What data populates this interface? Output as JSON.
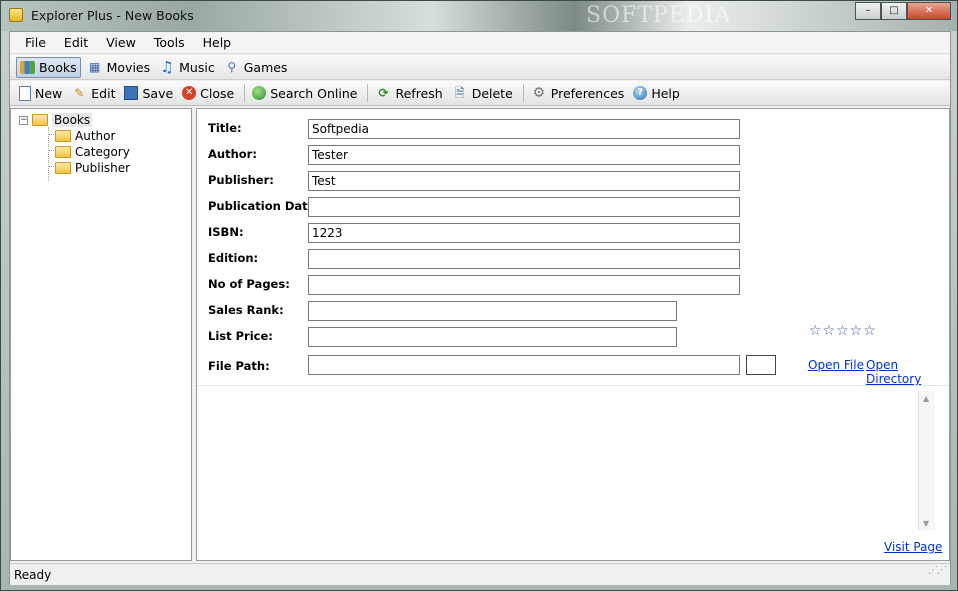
{
  "window": {
    "title": "Explorer Plus - New Books",
    "watermark": "SOFTPEDIA",
    "controls": {
      "minimize": "–",
      "maximize": "□",
      "close": "✕"
    }
  },
  "menu": [
    "File",
    "Edit",
    "View",
    "Tools",
    "Help"
  ],
  "categories": [
    {
      "label": "Books",
      "icon": "books-icon",
      "active": true
    },
    {
      "label": "Movies",
      "icon": "film-icon",
      "active": false
    },
    {
      "label": "Music",
      "icon": "music-note-icon",
      "active": false
    },
    {
      "label": "Games",
      "icon": "joystick-icon",
      "active": false
    }
  ],
  "actions": [
    {
      "label": "New",
      "icon": "new-document-icon"
    },
    {
      "label": "Edit",
      "icon": "pencil-icon"
    },
    {
      "label": "Save",
      "icon": "save-disk-icon"
    },
    {
      "label": "Close",
      "icon": "close-circle-icon"
    },
    {
      "label": "Search Online",
      "icon": "globe-search-icon"
    },
    {
      "label": "Refresh",
      "icon": "refresh-icon"
    },
    {
      "label": "Delete",
      "icon": "delete-icon"
    },
    {
      "label": "Preferences",
      "icon": "gear-icon"
    },
    {
      "label": "Help",
      "icon": "help-icon"
    }
  ],
  "tree": {
    "root": "Books",
    "children": [
      "Author",
      "Category",
      "Publisher"
    ]
  },
  "form": {
    "title_label": "Title:",
    "title_value": "Softpedia",
    "author_label": "Author:",
    "author_value": "Tester",
    "publisher_label": "Publisher:",
    "publisher_value": "Test",
    "pubdate_label": "Publication Date:",
    "pubdate_value": "",
    "isbn_label": "ISBN:",
    "isbn_value": "1223",
    "edition_label": "Edition:",
    "edition_value": "",
    "pages_label": "No of Pages:",
    "pages_value": "",
    "salesrank_label": "Sales Rank:",
    "salesrank_value": "",
    "listprice_label": "List Price:",
    "listprice_value": "",
    "filepath_label": "File Path:",
    "filepath_value": "",
    "rating_stars": "☆☆☆☆☆",
    "open_file": "Open File",
    "open_directory": "Open Directory",
    "visit_page": "Visit Page"
  },
  "status": {
    "text": "Ready"
  },
  "colors": {
    "link": "#0033cc",
    "accent": "#3b5998"
  }
}
